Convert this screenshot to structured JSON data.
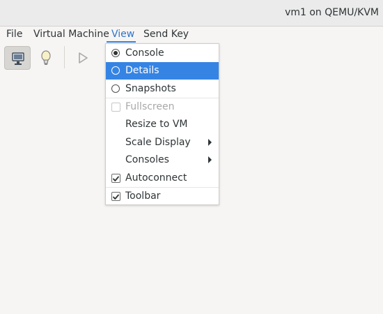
{
  "window": {
    "title": "vm1 on QEMU/KVM"
  },
  "menubar": {
    "items": [
      {
        "label": "File"
      },
      {
        "label": "Virtual Machine"
      },
      {
        "label": "View"
      },
      {
        "label": "Send Key"
      }
    ]
  },
  "toolbar": {
    "buttons": [
      {
        "icon": "monitor-icon",
        "pressed": true
      },
      {
        "icon": "lightbulb-icon",
        "pressed": false
      },
      {
        "icon": "play-icon",
        "pressed": false
      }
    ]
  },
  "view_menu": {
    "items": [
      {
        "label": "Console",
        "type": "radio",
        "checked": true,
        "selected": false,
        "disabled": false,
        "submenu": false
      },
      {
        "label": "Details",
        "type": "radio",
        "checked": false,
        "selected": true,
        "disabled": false,
        "submenu": false
      },
      {
        "label": "Snapshots",
        "type": "radio",
        "checked": false,
        "selected": false,
        "disabled": false,
        "submenu": false
      },
      {
        "label": "Fullscreen",
        "type": "check",
        "checked": false,
        "selected": false,
        "disabled": true,
        "submenu": false
      },
      {
        "label": "Resize to VM",
        "type": "plain",
        "checked": false,
        "selected": false,
        "disabled": false,
        "submenu": false
      },
      {
        "label": "Scale Display",
        "type": "plain",
        "checked": false,
        "selected": false,
        "disabled": false,
        "submenu": true
      },
      {
        "label": "Consoles",
        "type": "plain",
        "checked": false,
        "selected": false,
        "disabled": false,
        "submenu": true
      },
      {
        "label": "Autoconnect",
        "type": "check",
        "checked": true,
        "selected": false,
        "disabled": false,
        "submenu": false
      },
      {
        "label": "Toolbar",
        "type": "check",
        "checked": true,
        "selected": false,
        "disabled": false,
        "submenu": false
      }
    ]
  },
  "colors": {
    "accent": "#3584e4",
    "text": "#2e3436",
    "window_bg": "#f6f5f4"
  }
}
